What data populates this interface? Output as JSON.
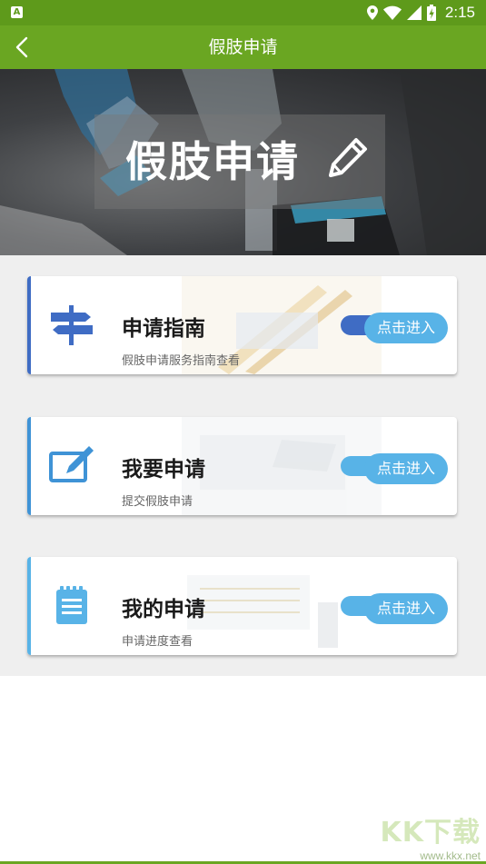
{
  "status_bar": {
    "notification_icon": "A",
    "time": "2:15",
    "icons": [
      "location-icon",
      "wifi-icon",
      "signal-icon",
      "battery-icon"
    ]
  },
  "app_bar": {
    "title": "假肢申请"
  },
  "banner": {
    "title": "假肢申请"
  },
  "cards": [
    {
      "title": "申请指南",
      "subtitle": "假肢申请服务指南查看",
      "button": "点击进入",
      "icon": "signpost-icon",
      "accent_color": "#3f6cc4"
    },
    {
      "title": "我要申请",
      "subtitle": "提交假肢申请",
      "button": "点击进入",
      "icon": "edit-form-icon",
      "accent_color": "#3f93d6"
    },
    {
      "title": "我的申请",
      "subtitle": "申请进度查看",
      "button": "点击进入",
      "icon": "notepad-icon",
      "accent_color": "#58b3e7"
    }
  ],
  "watermark": {
    "brand": "KK下载",
    "url": "www.kkx.net"
  },
  "colors": {
    "status_bar": "#5e9a1b",
    "app_bar": "#6aa622",
    "button": "#58b3e7",
    "content_bg": "#efefef"
  }
}
